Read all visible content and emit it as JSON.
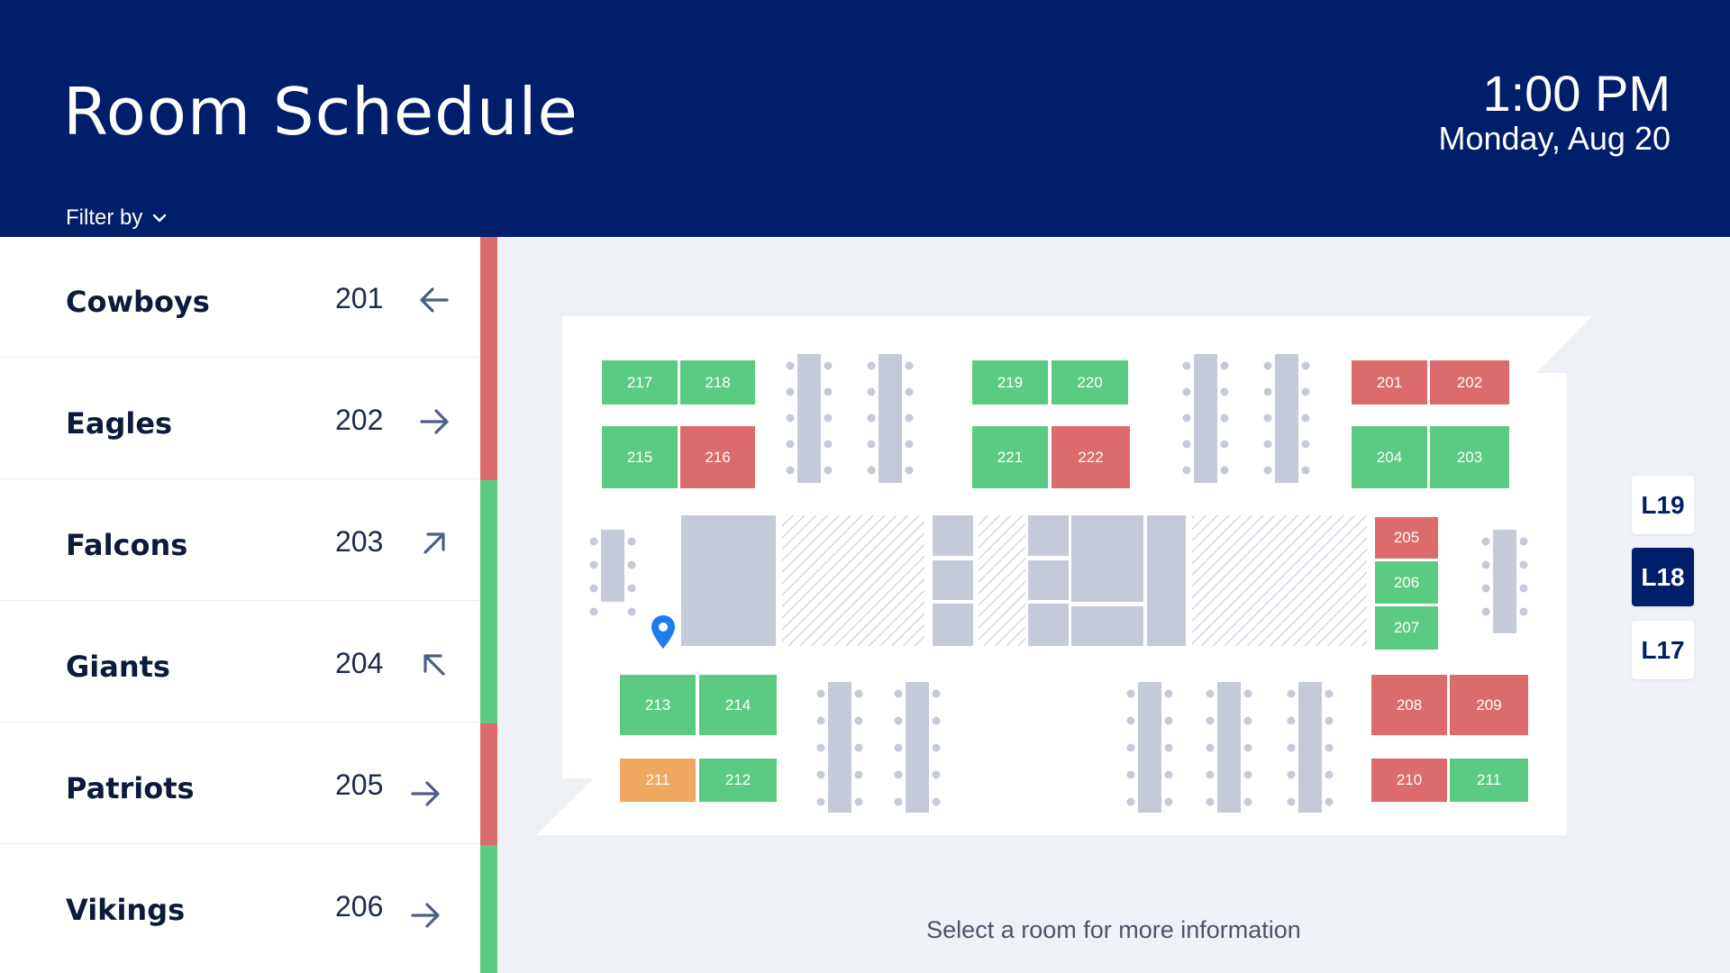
{
  "header": {
    "title": "Room Schedule",
    "filter_label": "Filter by",
    "time": "1:00 PM",
    "date": "Monday, Aug 20"
  },
  "colors": {
    "header": "#001e6a",
    "available": "#5ccb82",
    "occupied": "#dc6b6b",
    "pending": "#f0a860",
    "structure": "#c5cad9"
  },
  "rooms": [
    {
      "name": "Cowboys",
      "number": "201",
      "direction": "left",
      "status": "occupied"
    },
    {
      "name": "Eagles",
      "number": "202",
      "direction": "right",
      "status": "occupied"
    },
    {
      "name": "Falcons",
      "number": "203",
      "direction": "up-right",
      "status": "available"
    },
    {
      "name": "Giants",
      "number": "204",
      "direction": "up-left",
      "status": "available"
    },
    {
      "name": "Patriots",
      "number": "205",
      "direction": "right",
      "status": "occupied"
    },
    {
      "name": "Vikings",
      "number": "206",
      "direction": "right",
      "status": "available"
    }
  ],
  "map_rooms": [
    {
      "label": "217",
      "status": "available"
    },
    {
      "label": "218",
      "status": "available"
    },
    {
      "label": "215",
      "status": "available"
    },
    {
      "label": "216",
      "status": "occupied"
    },
    {
      "label": "219",
      "status": "available"
    },
    {
      "label": "220",
      "status": "available"
    },
    {
      "label": "221",
      "status": "available"
    },
    {
      "label": "222",
      "status": "occupied"
    },
    {
      "label": "201",
      "status": "occupied"
    },
    {
      "label": "202",
      "status": "occupied"
    },
    {
      "label": "204",
      "status": "available"
    },
    {
      "label": "203",
      "status": "available"
    },
    {
      "label": "205",
      "status": "occupied"
    },
    {
      "label": "206",
      "status": "available"
    },
    {
      "label": "207",
      "status": "available"
    },
    {
      "label": "213",
      "status": "available"
    },
    {
      "label": "214",
      "status": "available"
    },
    {
      "label": "211",
      "status": "pending"
    },
    {
      "label": "212",
      "status": "available"
    },
    {
      "label": "208",
      "status": "occupied"
    },
    {
      "label": "209",
      "status": "occupied"
    },
    {
      "label": "210",
      "status": "occupied"
    },
    {
      "label": "211",
      "status": "available"
    }
  ],
  "map_hint": "Select a room for more information",
  "floors": [
    {
      "label": "L19",
      "active": false
    },
    {
      "label": "L18",
      "active": true
    },
    {
      "label": "L17",
      "active": false
    }
  ],
  "icons": {
    "filter": "chevron-down-icon",
    "location": "map-pin-icon"
  }
}
